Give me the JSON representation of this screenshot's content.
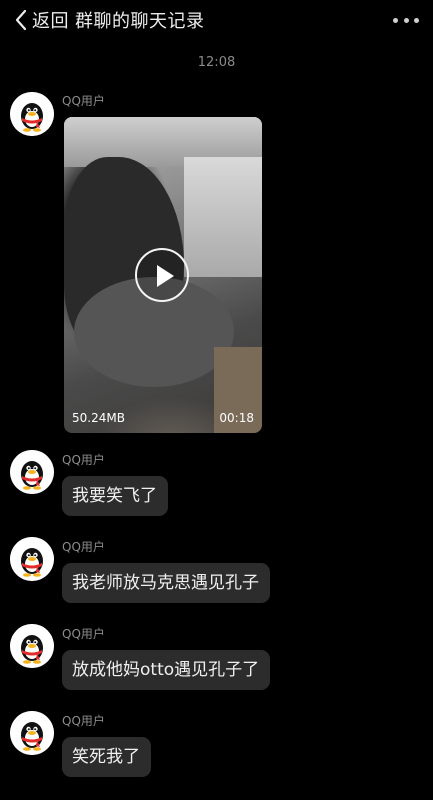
{
  "header": {
    "back_label": "返回",
    "title": "群聊的聊天记录",
    "back_icon": "chevron-left-icon",
    "more_icon": "more-dots-icon"
  },
  "timestamp": "12:08",
  "video_message": {
    "sender": "QQ用户",
    "file_size": "50.24MB",
    "duration": "00:18",
    "play_icon": "play-icon"
  },
  "messages": [
    {
      "sender": "QQ用户",
      "text": "我要笑飞了"
    },
    {
      "sender": "QQ用户",
      "text": "我老师放马克思遇见孔子"
    },
    {
      "sender": "QQ用户",
      "text": "放成他妈otto遇见孔子了"
    },
    {
      "sender": "QQ用户",
      "text": "笑死我了"
    }
  ],
  "avatar_icon": "qq-penguin-icon",
  "colors": {
    "background": "#000000",
    "bubble": "#2c2c2c",
    "text": "#f0f0f0",
    "muted": "#8c8c8c",
    "penguin_scarf": "#e22b2b",
    "penguin_beak": "#f7b21b"
  }
}
